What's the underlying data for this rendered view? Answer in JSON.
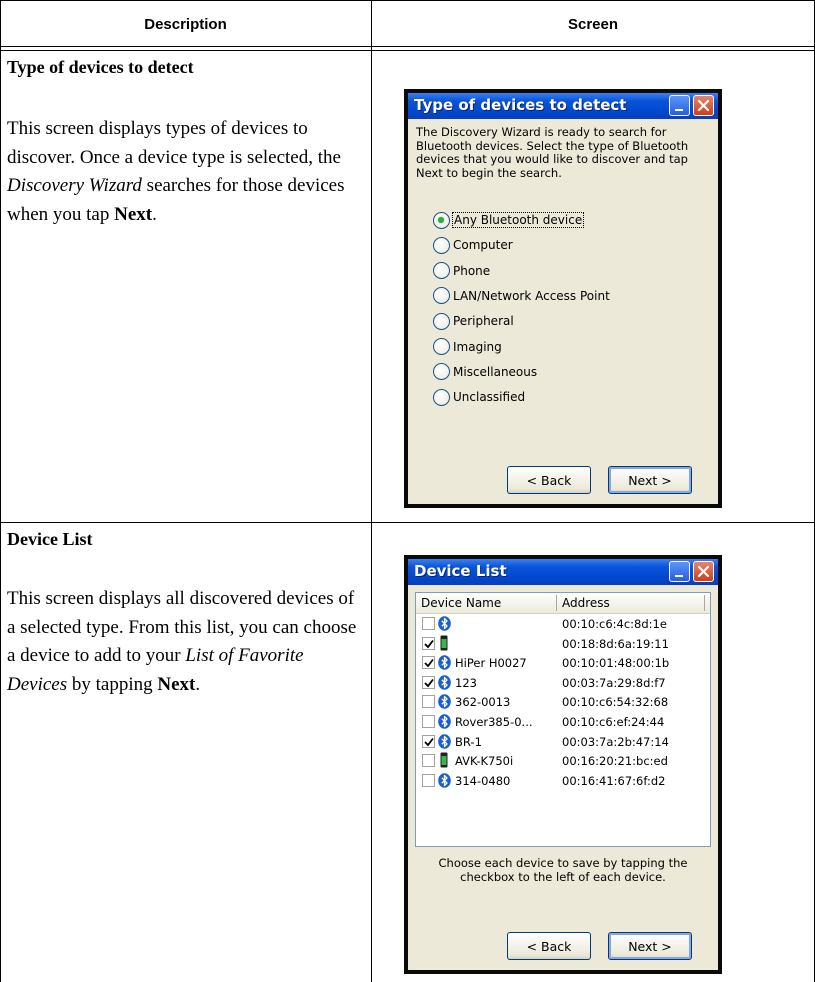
{
  "table": {
    "col_description": "Description",
    "col_screen": "Screen"
  },
  "section1": {
    "title": "Type of devices to detect",
    "body_1": "This screen displays types of devices to discover. Once a device type is selected, the ",
    "body_em": "Discovery Wizard",
    "body_2": " searches for those devices when you tap ",
    "body_bold": "Next",
    "body_3": "."
  },
  "section2": {
    "title": "Device List",
    "body_1": "This screen displays all discovered devices of a selected type. From this list, you can choose a device to add to your ",
    "body_em": "List of Favorite Devices",
    "body_2": " by tapping ",
    "body_bold": "Next",
    "body_3": "."
  },
  "screen1": {
    "title": "Type of devices to detect",
    "intro": "The Discovery Wizard is ready to search for Bluetooth devices. Select the type of Bluetooth devices that you would like to discover and tap Next to begin the search.",
    "options": [
      {
        "label": "Any Bluetooth device",
        "selected": true
      },
      {
        "label": "Computer",
        "selected": false
      },
      {
        "label": "Phone",
        "selected": false
      },
      {
        "label": "LAN/Network Access Point",
        "selected": false
      },
      {
        "label": "Peripheral",
        "selected": false
      },
      {
        "label": "Imaging",
        "selected": false
      },
      {
        "label": "Miscellaneous",
        "selected": false
      },
      {
        "label": "Unclassified",
        "selected": false
      }
    ],
    "back_label": "< Back",
    "next_label": "Next >"
  },
  "screen2": {
    "title": "Device List",
    "col_name": "Device Name",
    "col_address": "Address",
    "devices": [
      {
        "name": "",
        "address": "00:10:c6:4c:8d:1e",
        "checked": false,
        "icon": "bluetooth-icon"
      },
      {
        "name": "",
        "address": "00:18:8d:6a:19:11",
        "checked": true,
        "icon": "phone-icon"
      },
      {
        "name": "HiPer H0027",
        "address": "00:10:01:48:00:1b",
        "checked": true,
        "icon": "bluetooth-icon"
      },
      {
        "name": "123",
        "address": "00:03:7a:29:8d:f7",
        "checked": true,
        "icon": "bluetooth-icon"
      },
      {
        "name": "362-0013",
        "address": "00:10:c6:54:32:68",
        "checked": false,
        "icon": "bluetooth-icon"
      },
      {
        "name": "Rover385-0...",
        "address": "00:10:c6:ef:24:44",
        "checked": false,
        "icon": "bluetooth-icon"
      },
      {
        "name": "BR-1",
        "address": "00:03:7a:2b:47:14",
        "checked": true,
        "icon": "bluetooth-icon"
      },
      {
        "name": "AVK-K750i",
        "address": "00:16:20:21:bc:ed",
        "checked": false,
        "icon": "phone-icon"
      },
      {
        "name": "314-0480",
        "address": "00:16:41:67:6f:d2",
        "checked": false,
        "icon": "bluetooth-icon"
      }
    ],
    "help": "Choose each device to save by tapping the checkbox to the left of each device.",
    "back_label": "< Back",
    "next_label": "Next >"
  }
}
